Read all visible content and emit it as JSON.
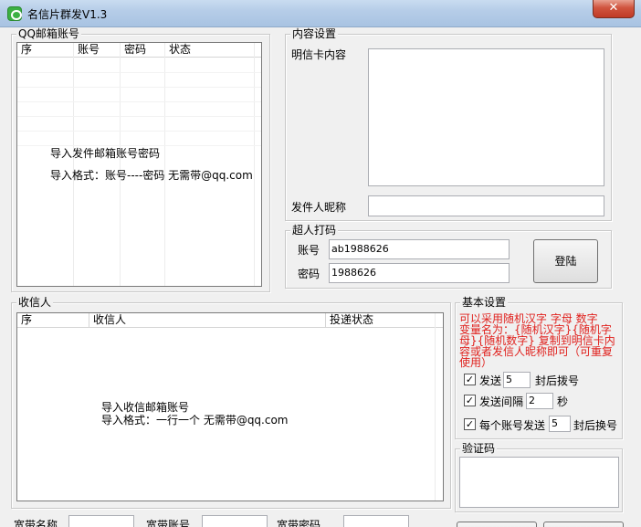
{
  "window": {
    "title": "名信片群发V1.3",
    "close_glyph": "✕"
  },
  "qq_accounts": {
    "group_label": "QQ邮箱账号",
    "columns": [
      "序",
      "账号",
      "密码",
      "状态"
    ],
    "hint_line1": "导入发件邮箱账号密码",
    "hint_line2": "导入格式：账号----密码 无需带@qq.com"
  },
  "content": {
    "group_label": "内容设置",
    "card_content_label": "明信卡内容",
    "card_content_value": "",
    "sender_nick_label": "发件人昵称",
    "sender_nick_value": ""
  },
  "captcha_service": {
    "group_label": "超人打码",
    "account_label": "账号",
    "account_value": "ab1988626",
    "password_label": "密码",
    "password_value": "1988626",
    "login_label": "登陆"
  },
  "recipients": {
    "group_label": "收信人",
    "columns": [
      "序",
      "收信人",
      "投递状态"
    ],
    "hint_line1": "导入收信邮箱账号",
    "hint_line2": "导入格式：一行一个 无需带@qq.com"
  },
  "basic": {
    "group_label": "基本设置",
    "note_lines": [
      "可以采用随机汉字 字母 数字",
      "变量名为：{随机汉字}{随机字",
      "母}{随机数字} 复制到明信卡内",
      "容或者发信人昵称即可（可重复",
      "使用）"
    ],
    "check_mark": "✓",
    "send_label": "发送",
    "send_value": "5",
    "send_suffix": "封后拨号",
    "interval_label": "发送间隔",
    "interval_value": "2",
    "interval_suffix": "秒",
    "per_account_label": "每个账号发送",
    "per_account_value": "5",
    "per_account_suffix": "封后换号"
  },
  "verify": {
    "group_label": "验证码"
  },
  "broadband": {
    "name_label": "宽带名称",
    "account_label": "宽带账号",
    "password_label": "宽带密码"
  }
}
